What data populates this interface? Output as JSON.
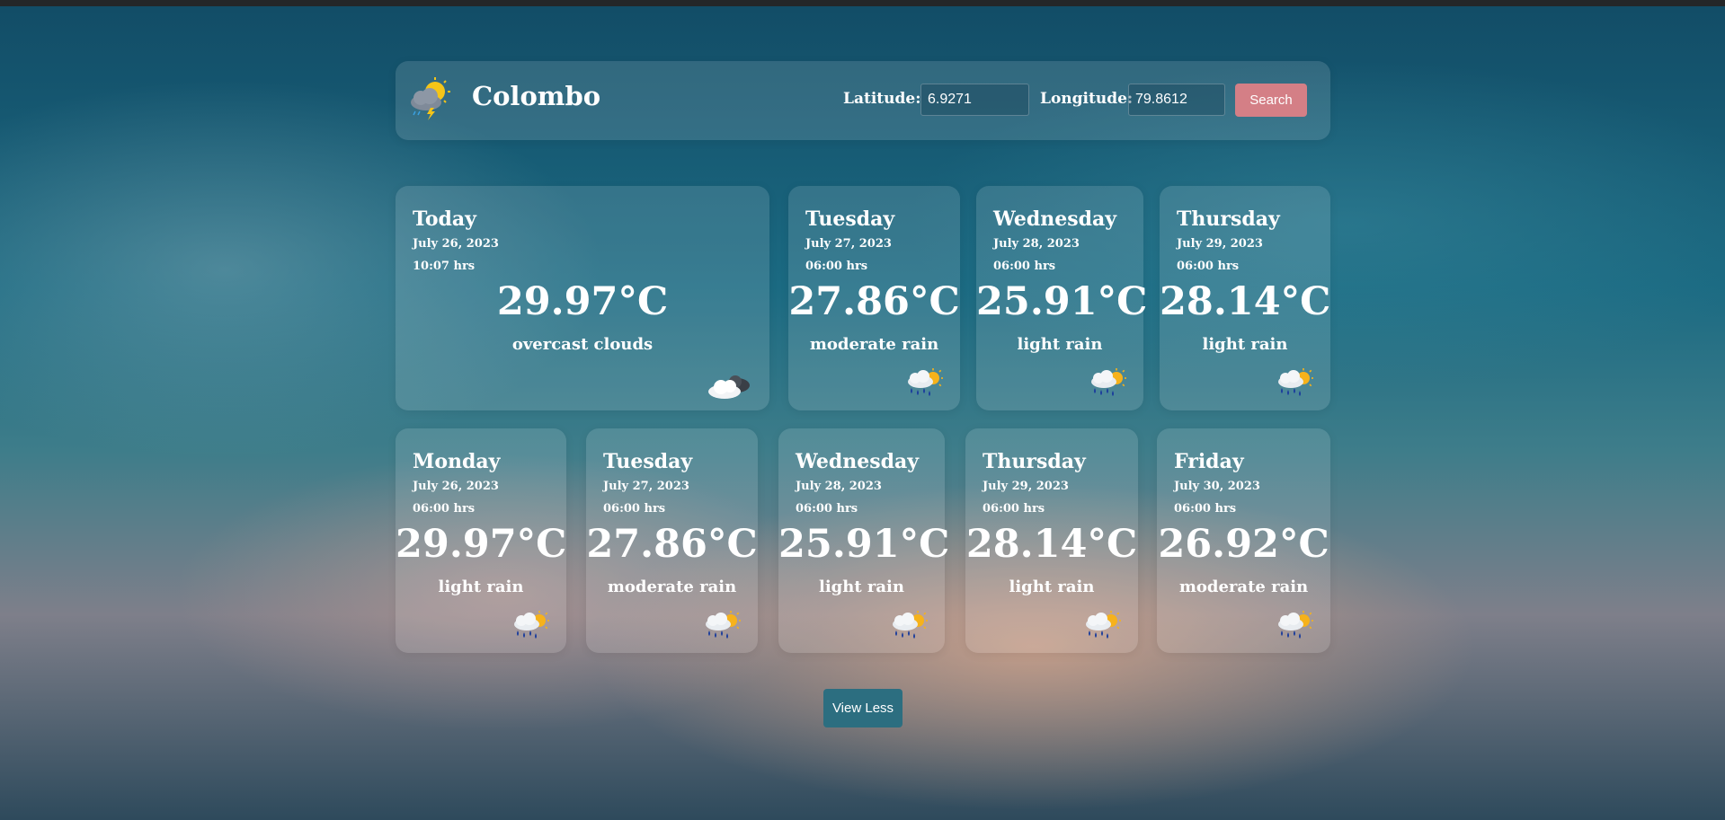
{
  "header": {
    "city": "Colombo",
    "latitude_label": "Latitude:",
    "latitude_value": "6.9271",
    "longitude_label": "Longitude:",
    "longitude_value": "79.8612",
    "search_label": "Search",
    "logo_icon": "sun-cloud-rain-icon"
  },
  "today": {
    "day": "Today",
    "date": "July 26, 2023",
    "time": "10:07 hrs",
    "temp": "29.97°C",
    "desc": "overcast clouds",
    "icon": "cloud-icon"
  },
  "forecast_top": [
    {
      "day": "Tuesday",
      "date": "July 27, 2023",
      "time": "06:00 hrs",
      "temp": "27.86°C",
      "desc": "moderate rain",
      "icon": "sun-rain-icon"
    },
    {
      "day": "Wednesday",
      "date": "July 28, 2023",
      "time": "06:00 hrs",
      "temp": "25.91°C",
      "desc": "light rain",
      "icon": "sun-rain-icon"
    },
    {
      "day": "Thursday",
      "date": "July 29, 2023",
      "time": "06:00 hrs",
      "temp": "28.14°C",
      "desc": "light rain",
      "icon": "sun-rain-icon"
    }
  ],
  "forecast_bottom": [
    {
      "day": "Monday",
      "date": "July 26, 2023",
      "time": "06:00 hrs",
      "temp": "29.97°C",
      "desc": "light rain",
      "icon": "sun-rain-icon"
    },
    {
      "day": "Tuesday",
      "date": "July 27, 2023",
      "time": "06:00 hrs",
      "temp": "27.86°C",
      "desc": "moderate rain",
      "icon": "sun-rain-icon"
    },
    {
      "day": "Wednesday",
      "date": "July 28, 2023",
      "time": "06:00 hrs",
      "temp": "25.91°C",
      "desc": "light rain",
      "icon": "sun-rain-icon"
    },
    {
      "day": "Thursday",
      "date": "July 29, 2023",
      "time": "06:00 hrs",
      "temp": "28.14°C",
      "desc": "light rain",
      "icon": "sun-rain-icon"
    },
    {
      "day": "Friday",
      "date": "July 30, 2023",
      "time": "06:00 hrs",
      "temp": "26.92°C",
      "desc": "moderate rain",
      "icon": "sun-rain-icon"
    }
  ],
  "view_less_label": "View Less",
  "colors": {
    "search_button": "#d47f86",
    "view_less_button": "#2c6e80"
  }
}
